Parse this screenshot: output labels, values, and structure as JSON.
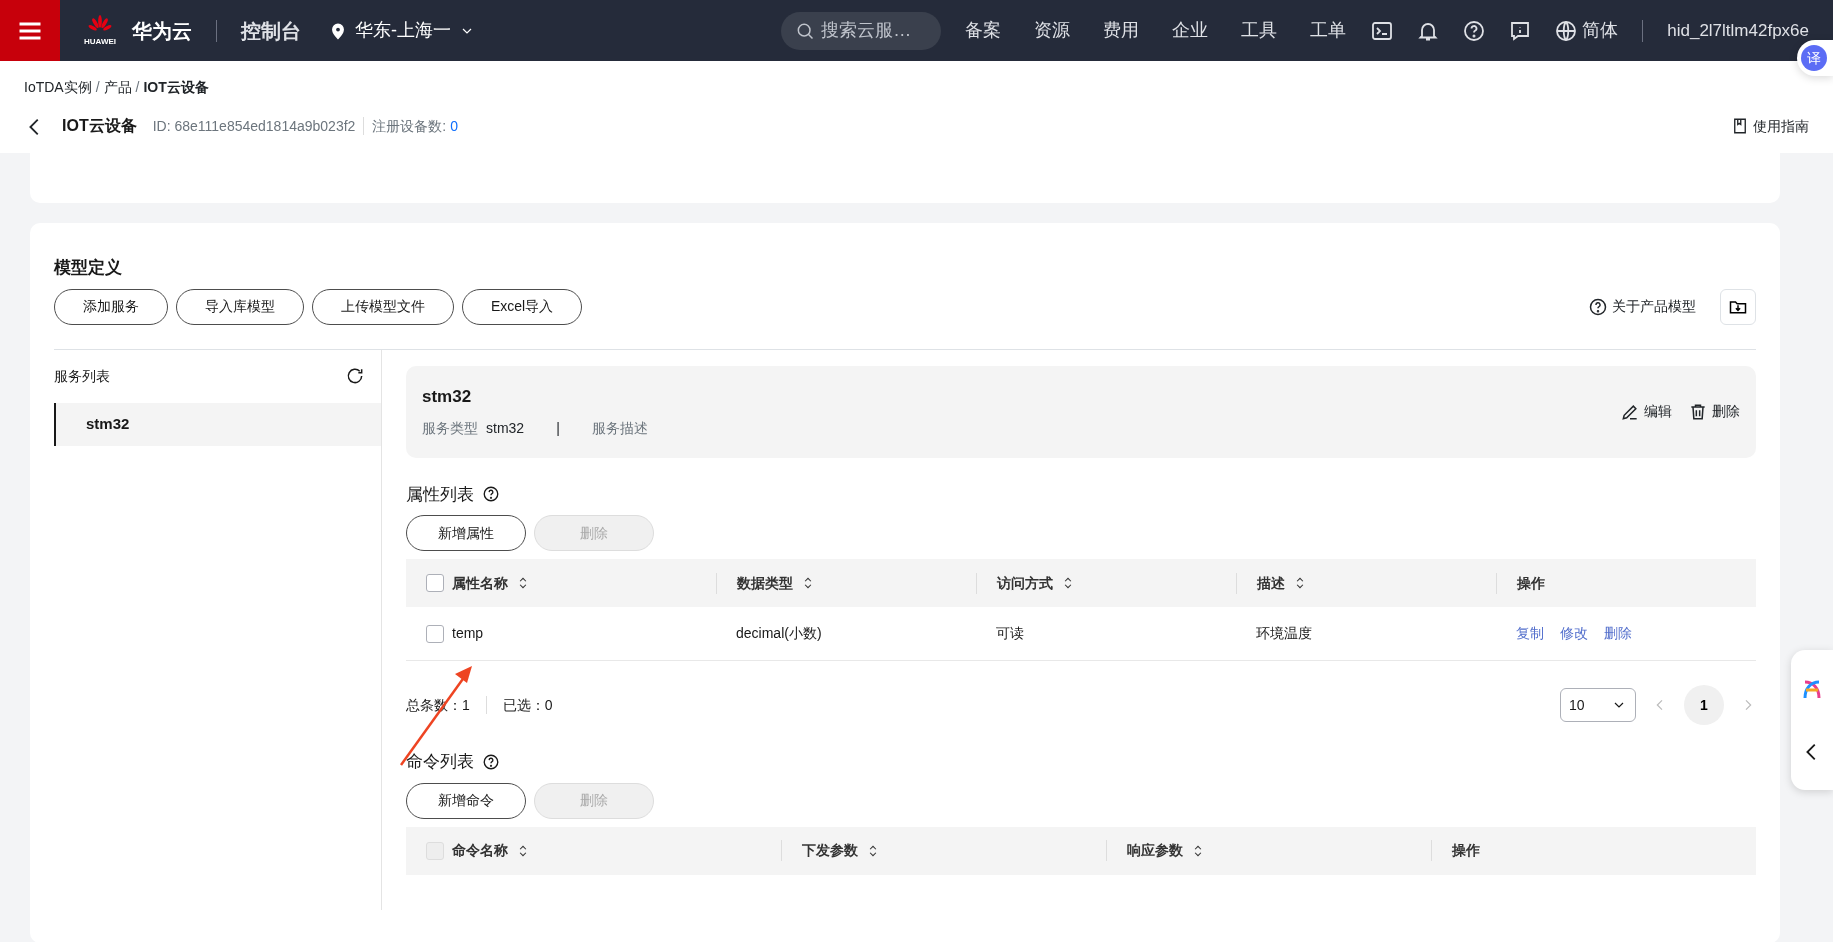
{
  "header": {
    "logo_text": "HUAWEI",
    "brand": "华为云",
    "console": "控制台",
    "region": "华东-上海一",
    "search": {
      "placeholder": "搜索云服…"
    },
    "nav": [
      "备案",
      "资源",
      "费用",
      "企业",
      "工具",
      "工单"
    ],
    "language": "简体",
    "user": "hid_2l7ltlm42fpx6e"
  },
  "translate_bubble": "译",
  "breadcrumb": {
    "separator": "/",
    "items": [
      "IoTDA实例",
      "产品",
      "IOT云设备"
    ]
  },
  "page": {
    "title": "IOT云设备",
    "id": "ID: 68e111e854ed1814a9b023f2",
    "registered_label": "注册设备数: ",
    "registered_value": "0",
    "guide": "使用指南"
  },
  "model": {
    "title": "模型定义",
    "buttons": [
      "添加服务",
      "导入库模型",
      "上传模型文件",
      "Excel导入"
    ],
    "about": "关于产品模型"
  },
  "services": {
    "title": "服务列表",
    "items": [
      {
        "name": "stm32",
        "selected": true
      }
    ]
  },
  "service_detail": {
    "name": "stm32",
    "type_label": "服务类型",
    "type_value": "stm32",
    "separator": "|",
    "desc_label": "服务描述",
    "actions": [
      "编辑",
      "删除"
    ]
  },
  "properties": {
    "title": "属性列表",
    "select_all": {
      "checked": false,
      "disabled": false
    },
    "buttons": [
      {
        "label": "新增属性",
        "disabled": false
      },
      {
        "label": "删除",
        "disabled": true
      }
    ],
    "columns": [
      {
        "label": "属性名称",
        "sortable": true
      },
      {
        "label": "数据类型",
        "sortable": true
      },
      {
        "label": "访问方式",
        "sortable": true
      },
      {
        "label": "描述",
        "sortable": true
      },
      {
        "label": "操作",
        "sortable": false
      }
    ],
    "rows": [
      {
        "checked": false,
        "cells": [
          "temp",
          "decimal(小数)",
          "可读",
          "环境温度"
        ],
        "actions": [
          "复制",
          "修改",
          "删除"
        ]
      }
    ],
    "total": "总条数：1",
    "selected_count": "已选：0",
    "page_size": "10",
    "pages": [
      {
        "label": "1",
        "selected": true
      }
    ]
  },
  "commands": {
    "title": "命令列表",
    "select_all": {
      "checked": false,
      "disabled": true
    },
    "buttons": [
      {
        "label": "新增命令",
        "disabled": false
      },
      {
        "label": "删除",
        "disabled": true
      }
    ],
    "columns": [
      {
        "label": "命令名称",
        "sortable": true
      },
      {
        "label": "下发参数",
        "sortable": true
      },
      {
        "label": "响应参数",
        "sortable": true
      },
      {
        "label": "操作",
        "sortable": false
      }
    ]
  }
}
